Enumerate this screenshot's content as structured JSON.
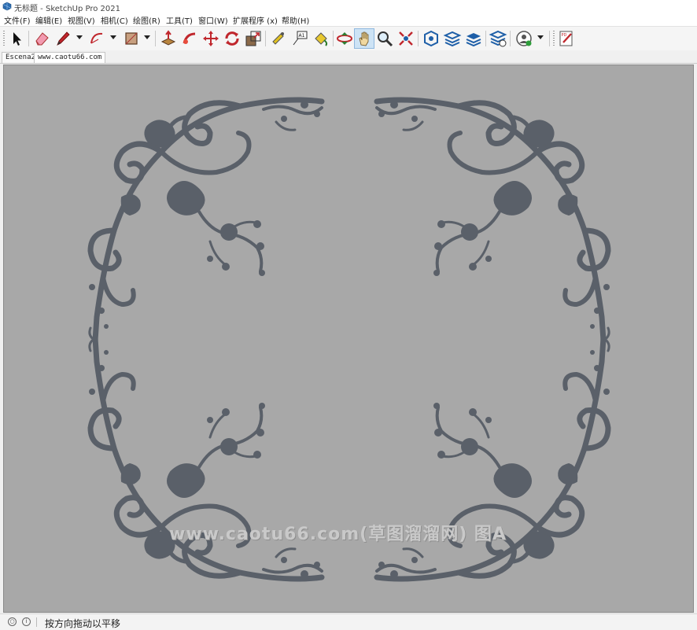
{
  "window": {
    "title": "无标题 - SketchUp Pro 2021"
  },
  "menu": {
    "items": [
      {
        "label": "文件(F)"
      },
      {
        "label": "编辑(E)"
      },
      {
        "label": "视图(V)"
      },
      {
        "label": "相机(C)"
      },
      {
        "label": "绘图(R)"
      },
      {
        "label": "工具(T)"
      },
      {
        "label": "窗口(W)"
      },
      {
        "label": "扩展程序 (x)"
      },
      {
        "label": "帮助(H)"
      }
    ]
  },
  "toolbar": {
    "icons": [
      "select-icon",
      "eraser-icon",
      "pencil-line-icon",
      "arc-icon",
      "rectangle-icon",
      "push-pull-icon",
      "follow-me-icon",
      "move-icon",
      "rotate-icon",
      "scale-icon",
      "tape-measure-icon",
      "text-icon",
      "paint-bucket-icon",
      "orbit-icon",
      "pan-icon",
      "zoom-icon",
      "zoom-extents-icon",
      "3d-warehouse-icon",
      "extension-warehouse-icon",
      "layout-icon",
      "extension-manager-icon",
      "account-icon",
      "send-to-layout-icon"
    ],
    "active": "pan-icon",
    "accent": "#cde3f5"
  },
  "scene_tabs": [
    {
      "label": "Escena2"
    },
    {
      "label": "www.caotu66.com"
    }
  ],
  "viewport": {
    "background": "#a8a8a8",
    "ornament_color": "#5a6069",
    "watermark": "www.caotu66.com(草图溜溜网) 图A"
  },
  "status": {
    "hint": "按方向拖动以平移"
  }
}
